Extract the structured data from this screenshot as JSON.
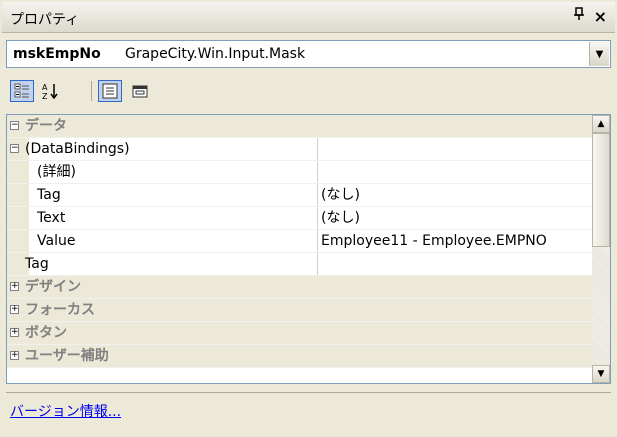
{
  "window": {
    "title": "プロパティ",
    "pin_glyph": "ꟷ",
    "pin_label": "ꟷ",
    "close_glyph": "×"
  },
  "object_selector": {
    "name": "mskEmpNo",
    "type": "GrapeCity.Win.Input.Mask",
    "dropdown_glyph": "▼"
  },
  "toolbar": {
    "buttons": [
      {
        "name": "categorized-button",
        "active": true
      },
      {
        "name": "alphabetical-button",
        "active": false
      },
      {
        "name": "properties-button",
        "active": true
      },
      {
        "name": "property-pages-button",
        "active": false
      }
    ]
  },
  "grid": {
    "rows": [
      {
        "kind": "category",
        "toggle": "⊟",
        "label": "データ"
      },
      {
        "kind": "top",
        "toggle": "⊟",
        "label": "(DataBindings)",
        "value": ""
      },
      {
        "kind": "sub",
        "label": "(詳細)",
        "value": ""
      },
      {
        "kind": "sub",
        "label": "Tag",
        "value": "(なし)"
      },
      {
        "kind": "sub",
        "label": "Text",
        "value": "(なし)"
      },
      {
        "kind": "sub",
        "label": "Value",
        "value": "Employee11 - Employee.EMPNO"
      },
      {
        "kind": "top",
        "label": "Tag",
        "value": ""
      },
      {
        "kind": "category",
        "toggle": "⊞",
        "label": "デザイン"
      },
      {
        "kind": "category",
        "toggle": "⊞",
        "label": "フォーカス"
      },
      {
        "kind": "category",
        "toggle": "⊞",
        "label": "ボタン"
      },
      {
        "kind": "category",
        "toggle": "⊞",
        "label": "ユーザー補助"
      }
    ]
  },
  "scrollbar": {
    "up_glyph": "▲",
    "down_glyph": "▼"
  },
  "footer": {
    "link_text": "バージョン情報..."
  }
}
